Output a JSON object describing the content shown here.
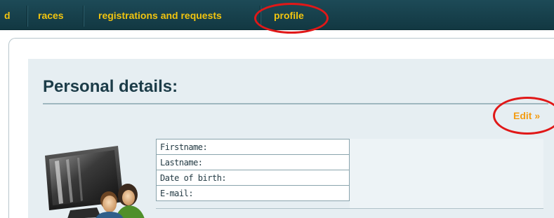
{
  "nav": {
    "items": [
      {
        "label": "d"
      },
      {
        "label": "races"
      },
      {
        "label": "registrations and requests"
      },
      {
        "label": "profile"
      }
    ]
  },
  "page": {
    "title": "Personal details:",
    "edit_label": "Edit »"
  },
  "details": {
    "fields": [
      {
        "label": "Firstname:"
      },
      {
        "label": "Lastname:"
      },
      {
        "label": "Date of birth:"
      },
      {
        "label": "E-mail:"
      }
    ]
  },
  "colors": {
    "nav_bg": "#123842",
    "nav_text": "#f1c40f",
    "title_text": "#1c3c48",
    "edit_link": "#f39c12",
    "annotation_circle": "#e01818",
    "panel_bg": "#e6eef2"
  },
  "icons": {
    "illustration": "computer-users-icon"
  }
}
